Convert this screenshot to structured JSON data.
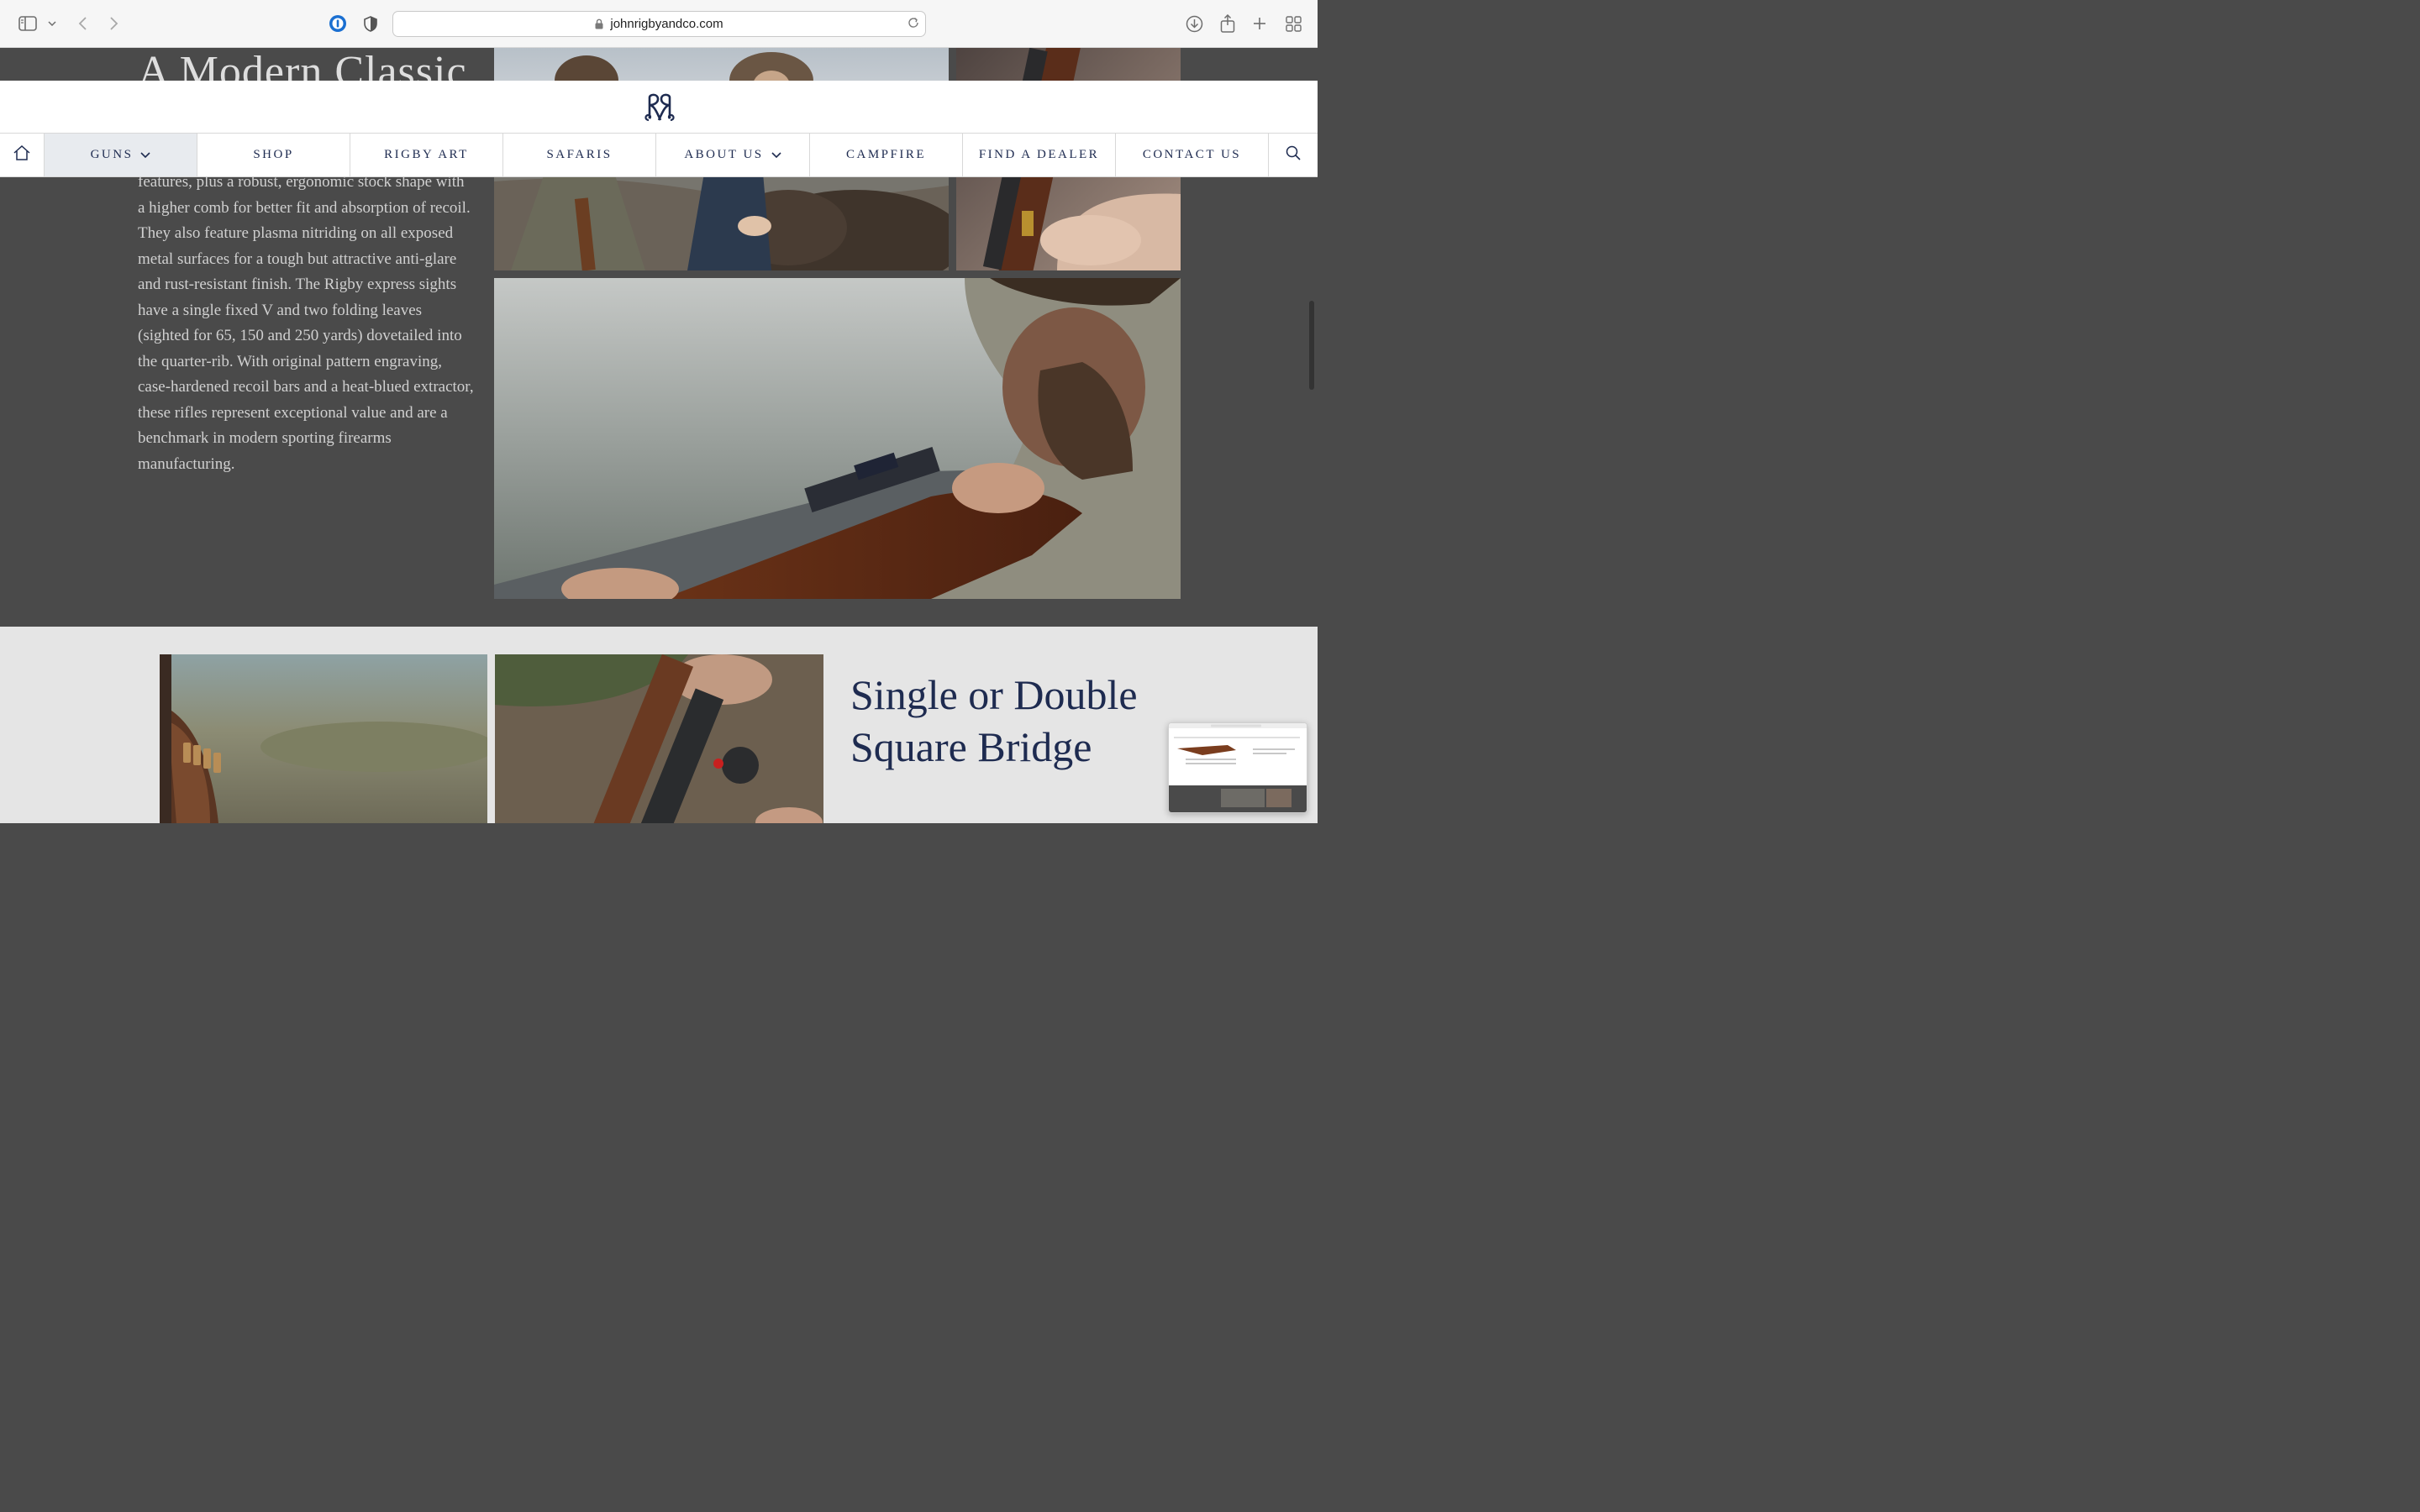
{
  "browser": {
    "url": "johnrigbyandco.com"
  },
  "section_dark": {
    "heading": "A Modern Classic",
    "body": "features, plus a robust, ergonomic stock shape with a higher comb for better fit and absorption of recoil. They also feature plasma nitriding on all exposed metal surfaces for a tough but attractive anti-glare and rust-resistant finish. The Rigby express sights have a single fixed V and two folding leaves (sighted for 65, 150 and 250 yards) dovetailed into the quarter-rib. With original pattern engraving, case-hardened recoil bars and a heat-blued extractor, these rifles represent exceptional value and are a benchmark in modern sporting firearms manufacturing."
  },
  "nav": {
    "items": [
      {
        "label": "GUNS"
      },
      {
        "label": "SHOP"
      },
      {
        "label": "RIGBY ART"
      },
      {
        "label": "SAFARIS"
      },
      {
        "label": "ABOUT US"
      },
      {
        "label": "CAMPFIRE"
      },
      {
        "label": "FIND A DEALER"
      },
      {
        "label": "CONTACT US"
      }
    ]
  },
  "section_light": {
    "heading_line1": "Single or Double",
    "heading_line2": "Square Bridge"
  },
  "colors": {
    "navy": "#1e2b50",
    "dark_bg": "#4a4a4a",
    "light_bg": "#e5e5e5"
  }
}
